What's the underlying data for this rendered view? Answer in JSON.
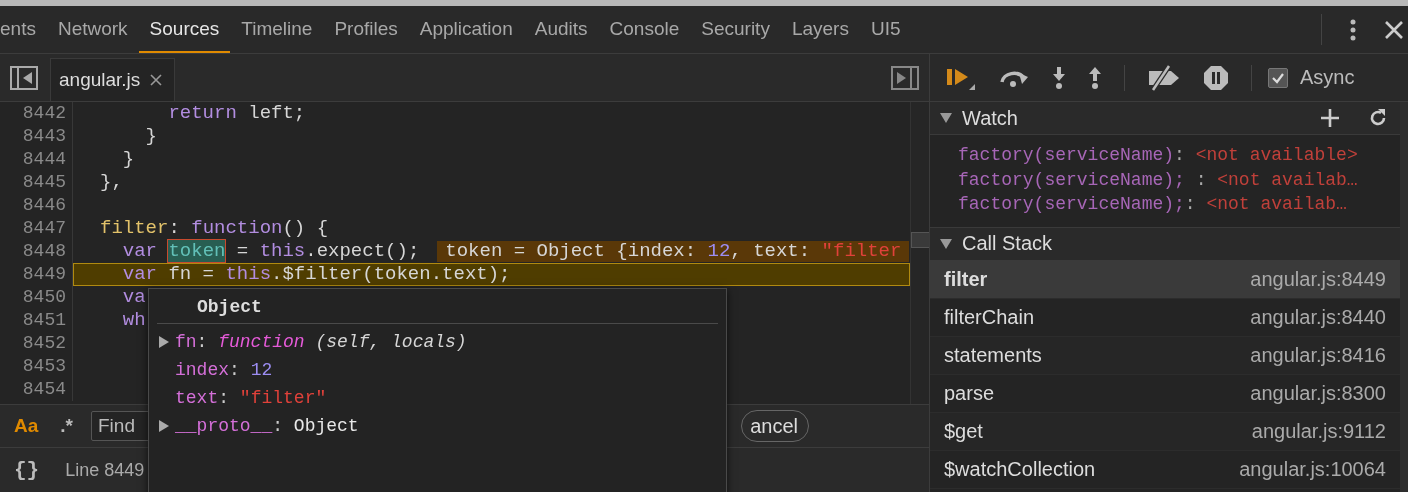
{
  "tabs": [
    {
      "label": "ents",
      "selected": false
    },
    {
      "label": "Network",
      "selected": false
    },
    {
      "label": "Sources",
      "selected": true
    },
    {
      "label": "Timeline",
      "selected": false
    },
    {
      "label": "Profiles",
      "selected": false
    },
    {
      "label": "Application",
      "selected": false
    },
    {
      "label": "Audits",
      "selected": false
    },
    {
      "label": "Console",
      "selected": false
    },
    {
      "label": "Security",
      "selected": false
    },
    {
      "label": "Layers",
      "selected": false
    },
    {
      "label": "UI5",
      "selected": false
    }
  ],
  "editor": {
    "file_tab": {
      "label": "angular.js",
      "selected": true
    },
    "lines": [
      {
        "number": "8442",
        "paused": false,
        "tokens": [
          {
            "kind": "keyword",
            "text": "      return"
          },
          {
            "kind": "plain",
            "text": " left;"
          }
        ]
      },
      {
        "number": "8443",
        "paused": false,
        "tokens": [
          {
            "kind": "plain",
            "text": "    }"
          }
        ]
      },
      {
        "number": "8444",
        "paused": false,
        "tokens": [
          {
            "kind": "plain",
            "text": "  }"
          }
        ]
      },
      {
        "number": "8445",
        "paused": false,
        "tokens": [
          {
            "kind": "plain",
            "text": "},"
          }
        ]
      },
      {
        "number": "8446",
        "paused": false
      },
      {
        "number": "8447",
        "paused": false,
        "tokens": [
          {
            "kind": "property",
            "text": "filter"
          },
          {
            "kind": "plain",
            "text": ": "
          },
          {
            "kind": "keyword",
            "text": "function"
          },
          {
            "kind": "plain",
            "text": "() {"
          }
        ]
      },
      {
        "number": "8448",
        "paused": false,
        "tokens": [
          {
            "kind": "keyword",
            "text": "  var "
          },
          {
            "kind": "highlight",
            "text": "token"
          },
          {
            "kind": "plain",
            "text": " = "
          },
          {
            "kind": "keyword",
            "text": "this"
          },
          {
            "kind": "plain",
            "text": ".expect();"
          }
        ],
        "inline_value": [
          {
            "kind": "plain",
            "text": "token = Object {index: "
          },
          {
            "kind": "number",
            "text": "12"
          },
          {
            "kind": "plain",
            "text": ", text: "
          },
          {
            "kind": "string",
            "text": "\"filter"
          }
        ]
      },
      {
        "number": "8449",
        "paused": true,
        "tokens": [
          {
            "kind": "keyword",
            "text": "  var"
          },
          {
            "kind": "plain",
            "text": " fn = "
          },
          {
            "kind": "keyword",
            "text": "this"
          },
          {
            "kind": "plain",
            "text": ".$filter(token.text);"
          }
        ]
      },
      {
        "number": "8450",
        "paused": false,
        "tokens": [
          {
            "kind": "keyword",
            "text": "  va"
          }
        ]
      },
      {
        "number": "8451",
        "paused": false,
        "tokens": [
          {
            "kind": "keyword",
            "text": "  wh"
          }
        ]
      },
      {
        "number": "8452",
        "paused": false
      },
      {
        "number": "8453",
        "paused": false
      },
      {
        "number": "8454",
        "paused": false
      }
    ]
  },
  "find_bar": {
    "match_case": {
      "label": "Aa",
      "on": true
    },
    "regex": {
      "label": ".*",
      "on": false
    },
    "search": {
      "placeholder": "Find"
    },
    "cancel": "ancel"
  },
  "status_bar": {
    "pretty_print": "{}",
    "position": "Line 8449"
  },
  "popover": {
    "title": "Object",
    "rows": [
      {
        "expandable": true,
        "key": "fn",
        "separator": ":",
        "value": [
          {
            "kind": "function",
            "text": "function"
          },
          {
            "kind": "args",
            "text": " (self, locals)"
          }
        ]
      },
      {
        "expandable": false,
        "key": "index",
        "separator": ":",
        "value": [
          {
            "kind": "number",
            "text": "12"
          }
        ]
      },
      {
        "expandable": false,
        "key": "text",
        "separator": ":",
        "value": [
          {
            "kind": "string",
            "text": "\"filter\""
          }
        ]
      },
      {
        "expandable": true,
        "key": "__proto__",
        "separator": ":",
        "value": [
          {
            "kind": "object",
            "text": "Object"
          }
        ]
      }
    ]
  },
  "debugger": {
    "async": {
      "label": "Async",
      "checked": true
    },
    "watch": {
      "title": "Watch",
      "expanded": true,
      "items": [
        {
          "expression": "factory(serviceName)",
          "separator": ":",
          "value": "<not available>"
        },
        {
          "expression": "factory(serviceName);",
          "separator": " :",
          "value": "<not availab…"
        },
        {
          "expression": "factory(serviceName);",
          "separator": ":",
          "value": "<not availab…"
        }
      ]
    },
    "call_stack": {
      "title": "Call Stack",
      "expanded": true,
      "frames": [
        {
          "name": "filter",
          "location": "angular.js:8449",
          "selected": true
        },
        {
          "name": "filterChain",
          "location": "angular.js:8440",
          "selected": false
        },
        {
          "name": "statements",
          "location": "angular.js:8416",
          "selected": false
        },
        {
          "name": "parse",
          "location": "angular.js:8300",
          "selected": false
        },
        {
          "name": "$get",
          "location": "angular.js:9112",
          "selected": false
        },
        {
          "name": "$watchCollection",
          "location": "angular.js:10064",
          "selected": false
        }
      ]
    }
  }
}
